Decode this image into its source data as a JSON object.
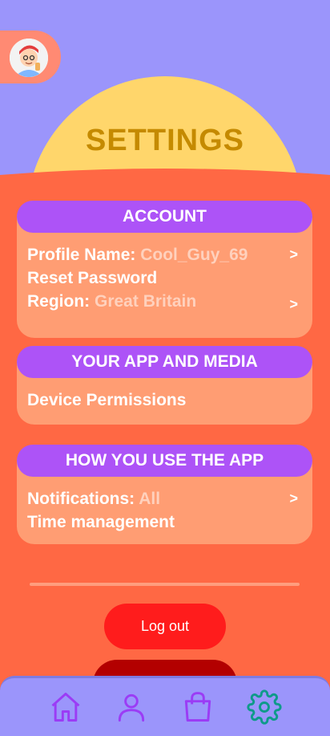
{
  "header": {
    "title": "SETTINGS"
  },
  "sections": [
    {
      "title": "ACCOUNT",
      "rows": [
        {
          "label": "Profile Name:",
          "value": "Cool_Guy_69",
          "chevron": ">"
        },
        {
          "label": "Reset Password",
          "value": "",
          "chevron": ""
        },
        {
          "label": "Region:",
          "value": "Great Britain",
          "chevron": ">"
        }
      ]
    },
    {
      "title": "YOUR APP AND MEDIA",
      "rows": [
        {
          "label": "Device Permissions",
          "value": "",
          "chevron": ""
        }
      ]
    },
    {
      "title": "HOW YOU USE THE APP",
      "rows": [
        {
          "label": "Notifications:",
          "value": "All",
          "chevron": ">"
        },
        {
          "label": "Time management",
          "value": "",
          "chevron": ""
        }
      ]
    }
  ],
  "actions": {
    "logout_label": "Log out"
  },
  "nav": [
    {
      "icon": "home-icon",
      "active": false
    },
    {
      "icon": "profile-icon",
      "active": false
    },
    {
      "icon": "shopping-bag-icon",
      "active": false
    },
    {
      "icon": "settings-gear-icon",
      "active": true
    }
  ],
  "colors": {
    "background": "#9b95fb",
    "main_panel": "#ff6844",
    "card": "#ff9d73",
    "section_header": "#ad53f7",
    "title_sun": "#ffd66b",
    "title_text": "#c58a00",
    "logout": "#ff1c1c",
    "nav_icon": "#9b3cf5",
    "nav_icon_active": "#0f9a8a"
  }
}
